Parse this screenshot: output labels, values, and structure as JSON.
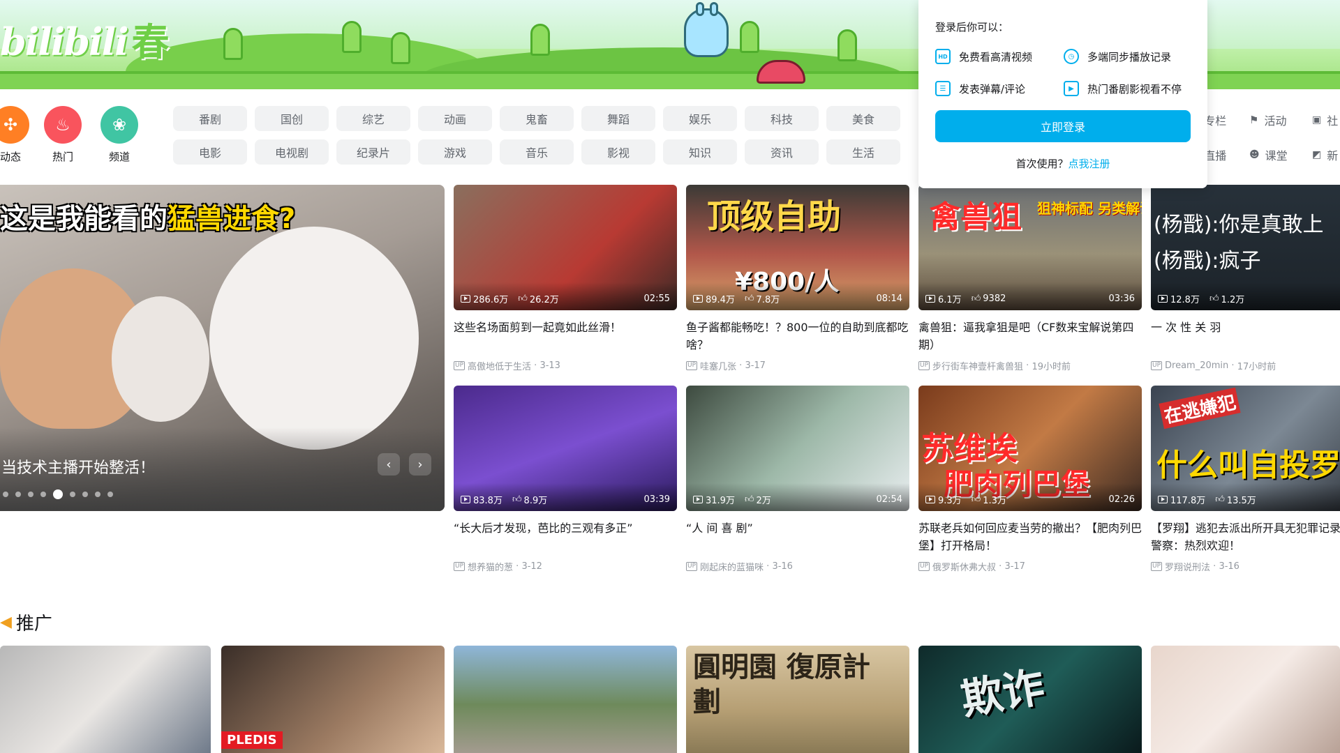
{
  "banner": {
    "logo_text": "bilibili",
    "logo_season": "春"
  },
  "quick_nav": [
    {
      "label": "动态",
      "icon": "pinwheel-icon",
      "color": "#ff7f24"
    },
    {
      "label": "热门",
      "icon": "flame-icon",
      "color": "#f9545d"
    },
    {
      "label": "频道",
      "icon": "channel-icon",
      "color": "#40c5a3"
    }
  ],
  "channels": {
    "row1": [
      "番剧",
      "国创",
      "综艺",
      "动画",
      "鬼畜",
      "舞蹈",
      "娱乐",
      "科技",
      "美食"
    ],
    "row2": [
      "电影",
      "电视剧",
      "纪录片",
      "游戏",
      "音乐",
      "影视",
      "知识",
      "资讯",
      "生活"
    ]
  },
  "right_nav": {
    "row1": [
      {
        "label": "专栏",
        "icon": "column-icon"
      },
      {
        "label": "活动",
        "icon": "flag-icon"
      },
      {
        "label": "社",
        "icon": "community-icon"
      }
    ],
    "row2": [
      {
        "label": "直播",
        "icon": "live-icon"
      },
      {
        "label": "课堂",
        "icon": "classroom-icon"
      },
      {
        "label": "新",
        "icon": "new-icon"
      }
    ]
  },
  "carousel": {
    "title_prefix": "这是我能看的",
    "title_highlight": "猛兽进食?",
    "caption": "当技术主播开始整活！",
    "prev_icon": "‹",
    "next_icon": "›",
    "dot_count": 9,
    "active_dot": 4
  },
  "videos": [
    {
      "title": "这些名场面剪到一起竟如此丝滑！",
      "views": "286.6万",
      "likes": "26.2万",
      "duration": "02:55",
      "author": "高傲地低于生活",
      "date": "3-13",
      "thumb_text": "",
      "thumb_bg": "linear-gradient(135deg,#8a6f5e,#b83a33 60%,#3e2a26)"
    },
    {
      "title": "鱼子酱都能畅吃！？800一位的自助到底都吃啥？",
      "views": "89.4万",
      "likes": "7.8万",
      "duration": "08:14",
      "author": "哇塞几张",
      "date": "3-17",
      "thumb_text": "顶级自助",
      "thumb_text2": "¥800/人",
      "thumb_bg": "linear-gradient(180deg,#3b3a36,#b1574a 55%,#d9a56b)"
    },
    {
      "title": "禽兽狙：逼我拿狙是吧（CF数来宝解说第四期）",
      "views": "6.1万",
      "likes": "9382",
      "duration": "03:36",
      "author": "步行街车神壹杆禽兽狙",
      "date": "19小时前",
      "thumb_text": "禽兽狙",
      "thumb_text2": "狙神标配 另类解说",
      "thumb_bg": "linear-gradient(180deg,#6b6f73,#9a9178 55%,#5a4a3b)"
    },
    {
      "title": "一 次 性 关 羽",
      "views": "12.8万",
      "likes": "1.2万",
      "duration": "",
      "author": "Dream_20min",
      "date": "17小时前",
      "thumb_text": "(杨戬):你是真敢上",
      "thumb_text2": "(杨戬):疯子",
      "thumb_bg": "linear-gradient(180deg,#27313a,#1c2329)"
    },
    {
      "title": "“长大后才发现，芭比的三观有多正”",
      "views": "83.8万",
      "likes": "8.9万",
      "duration": "03:39",
      "author": "想养猫的葱",
      "date": "3-12",
      "thumb_text": "",
      "thumb_bg": "linear-gradient(160deg,#4b2a8c,#7b4fd0 50%,#2a1a5c)"
    },
    {
      "title": "“人 间 喜 剧”",
      "views": "31.9万",
      "likes": "2万",
      "duration": "02:54",
      "author": "刚起床的蓝猫咪",
      "date": "3-16",
      "thumb_text": "",
      "thumb_bg": "linear-gradient(135deg,#3d4a3f,#9db8a8 50%,#e9eef0)"
    },
    {
      "title": "苏联老兵如何回应麦当劳的撤出？【肥肉列巴堡】打开格局！",
      "views": "9.3万",
      "likes": "1.3万",
      "duration": "02:26",
      "author": "俄罗斯休弗大叔",
      "date": "3-17",
      "thumb_text": "苏维埃",
      "thumb_text2": "肥肉列巴堡",
      "thumb_bg": "linear-gradient(135deg,#7a3b1c,#c27a45 50%,#3b2a22)"
    },
    {
      "title": "【罗翔】逃犯去派出所开具无犯罪记录证明？警察：热烈欢迎！",
      "views": "117.8万",
      "likes": "13.5万",
      "duration": "",
      "author": "罗翔说刑法",
      "date": "3-16",
      "thumb_text": "在逃嫌犯",
      "thumb_text2": "什么叫自投罗网",
      "thumb_bg": "linear-gradient(135deg,#3a4350,#7c8894 50%,#2a2f36)"
    }
  ],
  "promo": {
    "title": "推广",
    "tiles": [
      {
        "text": "",
        "bg": "linear-gradient(135deg,#b8b8b8,#e9e6e3 50%,#6f7a8a)"
      },
      {
        "text": "PLEDIS",
        "bg": "linear-gradient(135deg,#3a2e28,#9c7b62 60%,#d9b89a)"
      },
      {
        "text": "",
        "bg": "linear-gradient(180deg,#8fb6d9,#6e8a5b 55%,#a39b8f)"
      },
      {
        "text": "圓明園 復原計劃",
        "bg": "linear-gradient(180deg,#d8c6a2,#b69f74 60%,#8a7a56)"
      },
      {
        "text": "欺诈",
        "bg": "linear-gradient(135deg,#0f2a2a,#1f5c57 50%,#0a1a1c)"
      },
      {
        "text": "",
        "bg": "linear-gradient(135deg,#e8d6cc,#f5ebe6 50%,#b8a196)"
      }
    ]
  },
  "login_popover": {
    "heading": "登录后你可以：",
    "perks": [
      {
        "label": "免费看高清视频",
        "icon": "hd-icon",
        "icon_text": "HD"
      },
      {
        "label": "多端同步播放记录",
        "icon": "clock-icon",
        "icon_text": "◷"
      },
      {
        "label": "发表弹幕/评论",
        "icon": "danmaku-icon",
        "icon_text": "☰"
      },
      {
        "label": "热门番剧影视看不停",
        "icon": "play-icon",
        "icon_text": "▶"
      }
    ],
    "login_button": "立即登录",
    "first_use": "首次使用？",
    "register_link": "点我注册"
  },
  "colors": {
    "accent": "#00aeec",
    "text": "#18191c",
    "muted": "#9499a0",
    "chip_bg": "#f1f2f3"
  }
}
